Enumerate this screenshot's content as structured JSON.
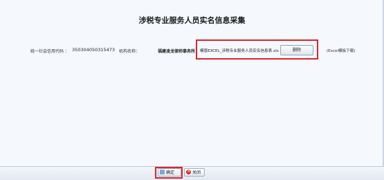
{
  "page": {
    "title": "涉税专业服务人员实名信息采集"
  },
  "form": {
    "uscc_label": "统一社会信用代码 ：",
    "uscc_value": "350304050315473",
    "org_name_label": "机构名称：",
    "org_name_value": "福建凌龙律师事务所",
    "file_name": "模版EXCEL_涉税专业服务人员实名信息表.xls",
    "delete_label": "删除",
    "template_download": "(Excel模板下载)"
  },
  "footer": {
    "confirm_label": "确定",
    "close_label": "关闭"
  },
  "colors": {
    "highlight": "#e0212d",
    "background": "#f5f8fc",
    "footer": "#e3e9f1"
  },
  "icons": {
    "confirm": "confirm-icon",
    "close": "close-icon"
  }
}
